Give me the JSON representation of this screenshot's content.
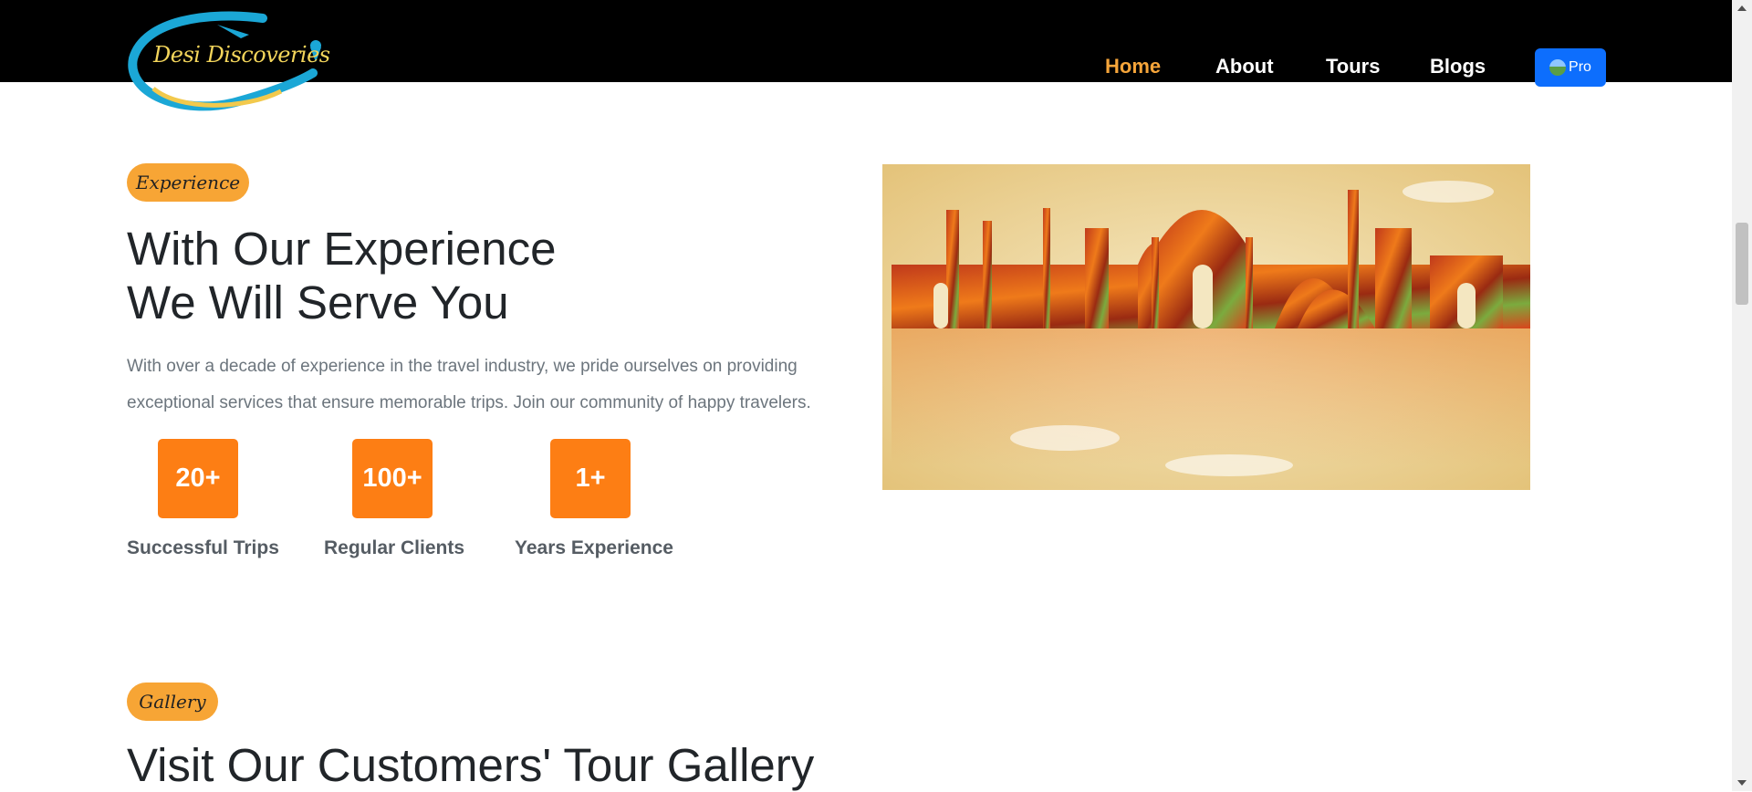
{
  "header": {
    "logo_text": "Desi Discoveries",
    "nav": [
      {
        "label": "Home",
        "active": true
      },
      {
        "label": "About",
        "active": false
      },
      {
        "label": "Tours",
        "active": false
      },
      {
        "label": "Blogs",
        "active": false
      }
    ],
    "profile_label": "Pro"
  },
  "experience": {
    "badge": "Experience",
    "title_line1": "With Our Experience",
    "title_line2": "We Will Serve You",
    "description": "With over a decade of experience in the travel industry, we pride ourselves on providing exceptional services that ensure memorable trips. Join our community of happy travelers.",
    "stats": [
      {
        "value": "20+",
        "label": "Successful Trips"
      },
      {
        "value": "100+",
        "label": "Regular Clients"
      },
      {
        "value": "1+",
        "label": "Years Experience"
      }
    ]
  },
  "gallery": {
    "badge": "Gallery",
    "title": "Visit Our Customers' Tour Gallery"
  },
  "colors": {
    "accent_orange": "#fd7e14",
    "badge_orange": "#f7a535",
    "nav_active": "#f6a53a",
    "primary_blue": "#0d6efd"
  }
}
